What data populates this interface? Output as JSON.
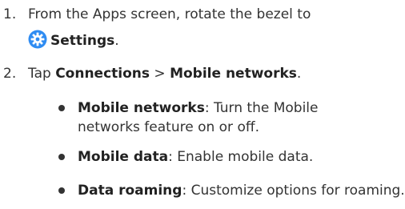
{
  "steps": [
    {
      "number": "1.",
      "lines": [
        "From the Apps screen, rotate the bezel to",
        "Settings",
        "."
      ],
      "icon": "settings-gear-icon"
    },
    {
      "number": "2.",
      "prefix": "Tap ",
      "item1": "Connections",
      "separator": " > ",
      "item2": "Mobile networks",
      "suffix": "."
    }
  ],
  "bullets": [
    {
      "term": "Mobile networks",
      "desc": ": Turn the Mobile networks feature on or off."
    },
    {
      "term": "Mobile data",
      "desc": ": Enable mobile data."
    },
    {
      "term": "Data roaming",
      "desc": ": Customize options for roaming."
    }
  ],
  "colors": {
    "text": "#333333",
    "icon_bg": "#2f8cf2"
  }
}
